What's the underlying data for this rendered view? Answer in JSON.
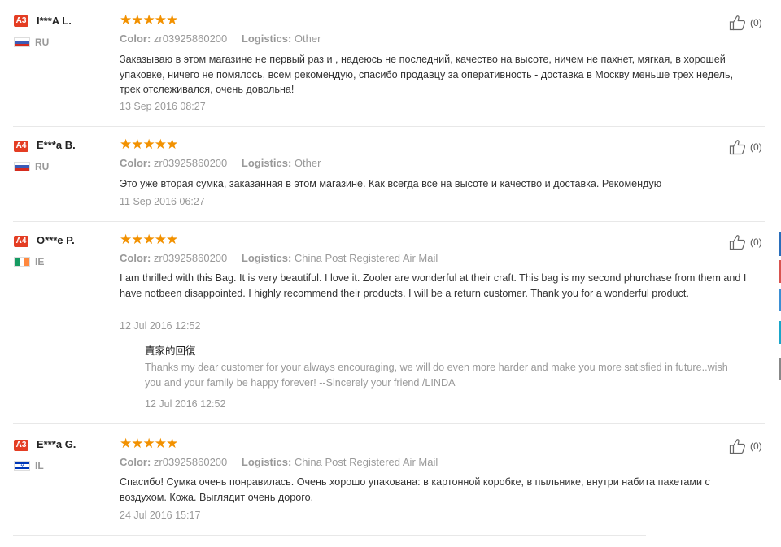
{
  "labels": {
    "color": "Color:",
    "logistics": "Logistics:"
  },
  "colors": {
    "badge": "#e43d23",
    "star": "#f29100"
  },
  "reviews": [
    {
      "badge": "A3",
      "name": "I***A L.",
      "country": "RU",
      "flag_icon": "russia-flag-icon",
      "rating": 5,
      "stars": "★★★★★",
      "color": "zr03925860200",
      "logistics": "Other",
      "text": "Заказываю в этом магазине не первый раз и , надеюсь не последний, качество на высоте, ничем не пахнет, мягкая, в хорошей упаковке, ничего не помялось, всем рекомендую, спасибо продавцу за оперативность - доставка в Москву меньше трех недель, трек отслеживался, очень довольна!",
      "date": "13 Sep 2016 08:27",
      "likes": "(0)"
    },
    {
      "badge": "A4",
      "name": "E***a B.",
      "country": "RU",
      "flag_icon": "russia-flag-icon",
      "rating": 5,
      "stars": "★★★★★",
      "color": "zr03925860200",
      "logistics": "Other",
      "text": "Это уже вторая сумка, заказанная в этом магазине. Как всегда все на высоте и качество и доставка. Рекомендую",
      "date": "11 Sep 2016 06:27",
      "likes": "(0)"
    },
    {
      "badge": "A4",
      "name": "O***e P.",
      "country": "IE",
      "flag_icon": "ireland-flag-icon",
      "rating": 5,
      "stars": "★★★★★",
      "color": "zr03925860200",
      "logistics": "China Post Registered Air Mail",
      "text": "I am thrilled with this Bag. It is very beautiful. I love it. Zooler are wonderful at their craft. This bag is my second phurchase from them and I have notbeen disappointed. I highly recommend their products. I will be a return customer. Thank you for a wonderful product.",
      "date": "12 Jul 2016 12:52",
      "likes": "(0)",
      "reply": {
        "title": "賣家的回復",
        "text": "Thanks my dear customer for your always encouraging, we will do even more harder and make you more satisfied in future..wish you and your family be happy forever! --Sincerely your friend /LINDA",
        "date": "12 Jul 2016 12:52"
      }
    },
    {
      "badge": "A3",
      "name": "E***a G.",
      "country": "IL",
      "flag_icon": "israel-flag-icon",
      "rating": 5,
      "stars": "★★★★★",
      "color": "zr03925860200",
      "logistics": "China Post Registered Air Mail",
      "text": "Спасибо! Сумка очень понравилась. Очень хорошо упакована: в картонной коробке, в пыльнике, внутри набита пакетами с воздухом. Кожа. Выглядит очень дорого.",
      "date": "24 Jul 2016 15:17",
      "likes": "(0)"
    }
  ]
}
